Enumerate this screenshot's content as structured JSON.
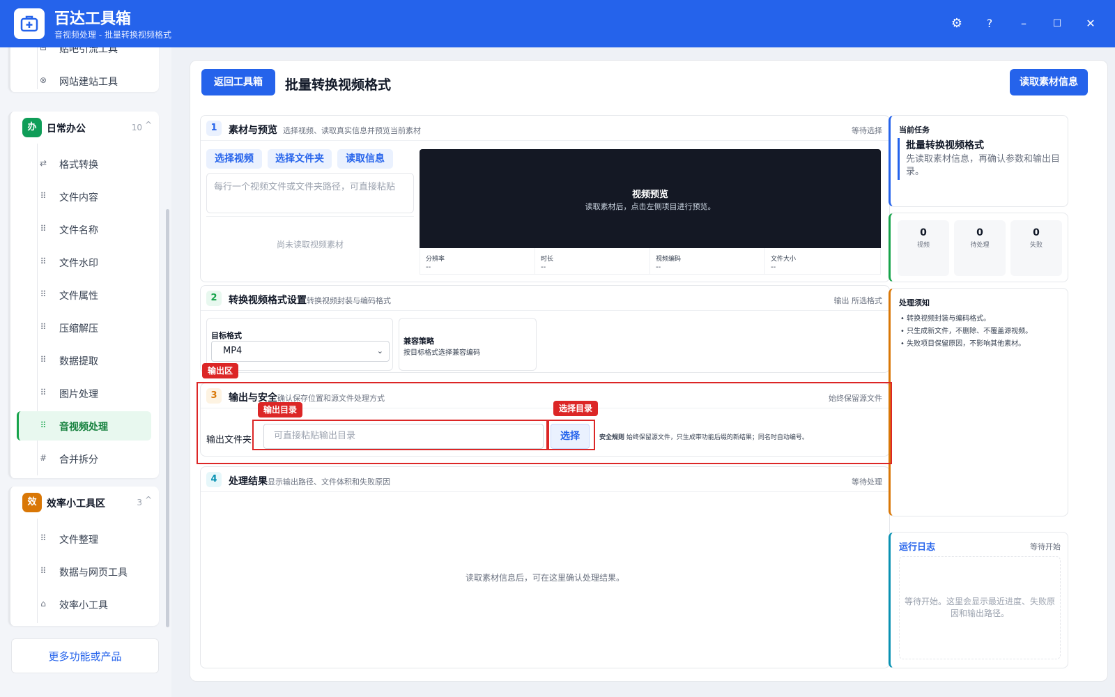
{
  "app": {
    "title": "百达工具箱",
    "subtitle": "音视频处理 - 批量转换视频格式",
    "controls": {
      "settings": "⚙",
      "help": "?",
      "minimize": "–",
      "maximize": "☐",
      "close": "✕"
    }
  },
  "sidebar": {
    "prev_items": [
      {
        "label": "贴吧引流工具",
        "icon": "⊟"
      },
      {
        "label": "网站建站工具",
        "icon": "⊗"
      }
    ],
    "groups": [
      {
        "badge": "办",
        "label": "日常办公",
        "count": "10",
        "caret": "^",
        "color": "#0f9d58",
        "items": [
          {
            "label": "格式转换",
            "icon": "⇄"
          },
          {
            "label": "文件内容",
            "icon": "⠿"
          },
          {
            "label": "文件名称",
            "icon": "⠿"
          },
          {
            "label": "文件水印",
            "icon": "⠿"
          },
          {
            "label": "文件属性",
            "icon": "⠿"
          },
          {
            "label": "压缩解压",
            "icon": "⠿"
          },
          {
            "label": "数据提取",
            "icon": "⠿"
          },
          {
            "label": "图片处理",
            "icon": "⠿"
          },
          {
            "label": "音视频处理",
            "icon": "⠿"
          },
          {
            "label": "合并拆分",
            "icon": "#"
          }
        ]
      },
      {
        "badge": "效",
        "label": "效率小工具区",
        "count": "3",
        "caret": "^",
        "color": "#d97706",
        "items": [
          {
            "label": "文件整理",
            "icon": "⠿"
          },
          {
            "label": "数据与网页工具",
            "icon": "⠿"
          },
          {
            "label": "效率小工具",
            "icon": "⌂"
          }
        ]
      }
    ],
    "more_label": "更多功能或产品"
  },
  "main": {
    "back_label": "返回工具箱",
    "title": "批量转换视频格式",
    "read_info_label": "读取素材信息",
    "sections": [
      {
        "num": "1",
        "title": "素材与预览",
        "desc": "选择视频、读取真实信息并预览当前素材",
        "status": "等待选择"
      },
      {
        "num": "2",
        "title": "转换视频格式设置",
        "desc": "转换视频封装与编码格式",
        "status": "输出 所选格式"
      },
      {
        "num": "3",
        "title": "输出与安全",
        "desc": "确认保存位置和源文件处理方式",
        "status": "始终保留源文件"
      },
      {
        "num": "4",
        "title": "处理结果",
        "desc": "显示输出路径、文件体积和失败原因",
        "status": "等待处理"
      }
    ],
    "material": {
      "buttons": [
        "选择视频",
        "选择文件夹",
        "读取信息"
      ],
      "path_placeholder": "每行一个视频文件或文件夹路径，可直接粘贴",
      "empty": "尚未读取视频素材",
      "preview_title": "视频预览",
      "preview_sub": "读取素材后，点击左侧项目进行预览。",
      "meta": [
        {
          "label": "分辨率",
          "value": "--"
        },
        {
          "label": "时长",
          "value": "--"
        },
        {
          "label": "视频编码",
          "value": "--"
        },
        {
          "label": "文件大小",
          "value": "--"
        }
      ]
    },
    "settings": {
      "format_label": "目标格式",
      "format_value": "MP4",
      "compat_title": "兼容策略",
      "compat_desc": "按目标格式选择兼容编码"
    },
    "output": {
      "label": "输出文件夹",
      "placeholder": "可直接粘贴输出目录",
      "choose_label": "选择",
      "rule_title": "安全规则",
      "rule_text": "始终保留源文件，只生成带功能后缀的新结果；同名时自动编号。"
    },
    "result_empty": "读取素材信息后，可在这里确认处理结果。"
  },
  "annotations": {
    "output_area": "输出区",
    "output_dir": "输出目录",
    "choose_dir": "选择目录"
  },
  "right": {
    "task_label": "当前任务",
    "task_title": "批量转换视频格式",
    "task_desc": "先读取素材信息，再确认参数和输出目录。",
    "stats": [
      {
        "num": "0",
        "label": "视频"
      },
      {
        "num": "0",
        "label": "待处理"
      },
      {
        "num": "0",
        "label": "失败"
      }
    ],
    "notes_title": "处理须知",
    "notes": [
      "转换视频封装与编码格式。",
      "只生成新文件，不删除、不覆盖源视频。",
      "失败项目保留原因，不影响其他素材。"
    ],
    "log_title": "运行日志",
    "log_status": "等待开始",
    "log_empty": "等待开始。这里会显示最近进度、失败原因和输出路径。"
  },
  "colors": {
    "brand": "#2563eb",
    "office_badge": "#0f9d58",
    "efficiency_badge": "#d97706",
    "highlight": "#dc2626"
  }
}
